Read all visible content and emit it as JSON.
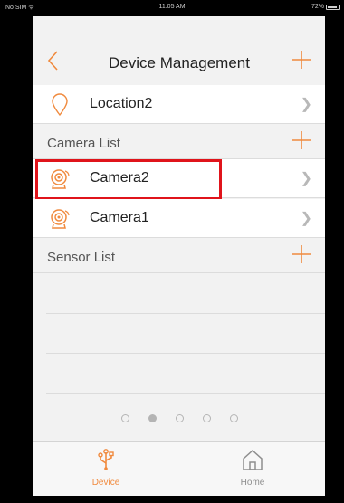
{
  "status_bar": {
    "carrier": "No SIM ᯤ",
    "time": "11:05 AM",
    "battery": "72%"
  },
  "nav": {
    "title": "Device Management",
    "back_icon": "chevron-left-icon",
    "add_icon": "plus-icon"
  },
  "location": {
    "label": "Location2",
    "icon": "map-pin-icon"
  },
  "camera_section": {
    "label": "Camera List"
  },
  "cameras": [
    {
      "label": "Camera2",
      "icon": "camera-icon",
      "highlighted": true
    },
    {
      "label": "Camera1",
      "icon": "camera-icon",
      "highlighted": false
    }
  ],
  "sensor_section": {
    "label": "Sensor List"
  },
  "pager": {
    "count": 5,
    "active_index": 1
  },
  "tabs": [
    {
      "label": "Device",
      "icon": "device-icon",
      "active": true
    },
    {
      "label": "Home",
      "icon": "home-icon",
      "active": false
    }
  ],
  "colors": {
    "accent": "#f08a3e",
    "highlight_border": "#e0141b",
    "background": "#f2f2f2"
  }
}
